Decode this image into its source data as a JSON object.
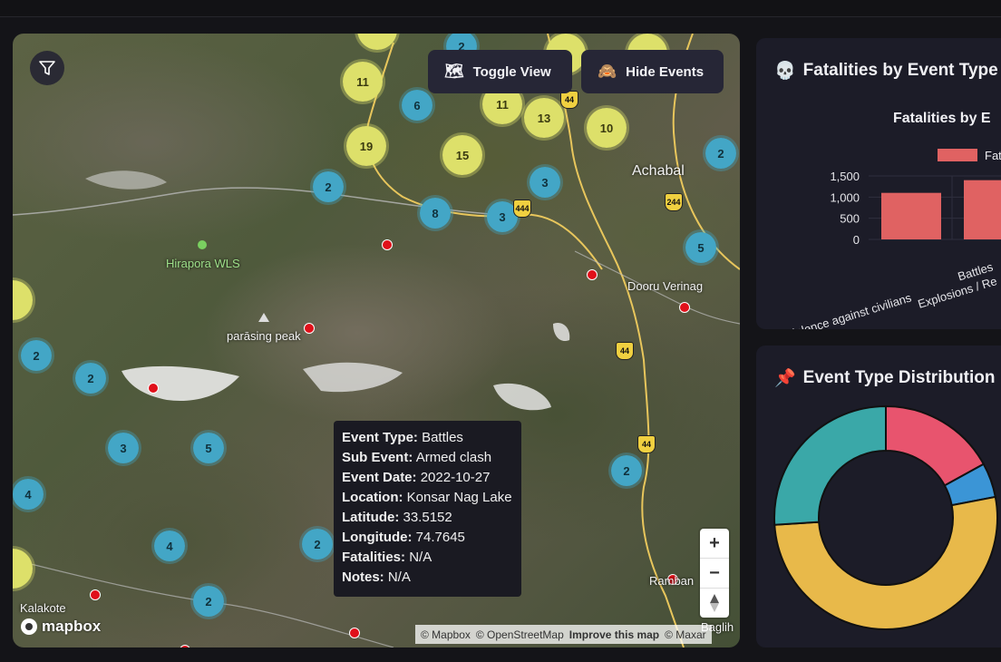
{
  "map": {
    "buttons": {
      "toggle_view": "Toggle View",
      "hide_events": "Hide Events"
    },
    "places": [
      {
        "id": "achabal",
        "label": "Achabal"
      },
      {
        "id": "hirapora",
        "label": "Hirapora WLS"
      },
      {
        "id": "parasing",
        "label": "parāsing peak"
      },
      {
        "id": "dooru",
        "label": "Dooru Verinag"
      },
      {
        "id": "kalakote",
        "label": "Kalakote"
      },
      {
        "id": "ramban",
        "label": "Ramban"
      },
      {
        "id": "baglihar",
        "label": "Baglih"
      }
    ],
    "highway_labels": [
      "44",
      "444",
      "244",
      "44",
      "44"
    ],
    "clusters": [
      {
        "count": "11",
        "color": "yellow"
      },
      {
        "count": "19",
        "color": "yellow"
      },
      {
        "count": "15",
        "color": "yellow"
      },
      {
        "count": "11",
        "color": "yellow"
      },
      {
        "count": "13",
        "color": "yellow"
      },
      {
        "count": "10",
        "color": "yellow"
      },
      {
        "count": "6",
        "color": "blue"
      },
      {
        "count": "2",
        "color": "blue"
      },
      {
        "count": "8",
        "color": "blue"
      },
      {
        "count": "3",
        "color": "blue"
      },
      {
        "count": "3",
        "color": "blue"
      },
      {
        "count": "2",
        "color": "blue"
      },
      {
        "count": "5",
        "color": "blue"
      },
      {
        "count": "2",
        "color": "blue"
      },
      {
        "count": "2",
        "color": "blue"
      },
      {
        "count": "3",
        "color": "blue"
      },
      {
        "count": "5",
        "color": "blue"
      },
      {
        "count": "4",
        "color": "blue"
      },
      {
        "count": "4",
        "color": "blue"
      },
      {
        "count": "2",
        "color": "blue"
      },
      {
        "count": "2",
        "color": "blue"
      },
      {
        "count": "2",
        "color": "blue"
      },
      {
        "count": "2",
        "color": "blue"
      }
    ],
    "tooltip": {
      "fields": [
        {
          "label": "Event Type:",
          "value": "Battles"
        },
        {
          "label": "Sub Event:",
          "value": "Armed clash"
        },
        {
          "label": "Event Date:",
          "value": "2022-10-27"
        },
        {
          "label": "Location:",
          "value": "Konsar Nag Lake"
        },
        {
          "label": "Latitude:",
          "value": "33.5152"
        },
        {
          "label": "Longitude:",
          "value": "74.7645"
        },
        {
          "label": "Fatalities:",
          "value": "N/A"
        },
        {
          "label": "Notes:",
          "value": "N/A"
        }
      ]
    },
    "zoom": {
      "in": "+",
      "out": "−"
    },
    "logo": "mapbox",
    "attribution": {
      "mapbox": "© Mapbox",
      "osm": "© OpenStreetMap",
      "improve": "Improve this map",
      "maxar": "© Maxar"
    }
  },
  "panels": {
    "fatalities": {
      "title": "Fatalities by Event Type",
      "icon": "💀",
      "chart_title": "Fatalities by E",
      "legend": "Fat"
    },
    "distribution": {
      "title": "Event Type Distribution",
      "icon": "📌"
    }
  },
  "chart_data": [
    {
      "type": "bar",
      "title": "Fatalities by E",
      "categories": [
        "Violence against civilians",
        "Battles",
        "Explosions / Re"
      ],
      "series": [
        {
          "name": "Fat",
          "values": [
            1100,
            1400
          ]
        }
      ],
      "yticks": [
        "1,500",
        "1,000",
        "500",
        "0"
      ],
      "ylim": [
        0,
        1500
      ],
      "colors": {
        "bar": "#e06262"
      }
    },
    {
      "type": "pie",
      "variant": "doughnut",
      "slices": [
        {
          "value": 17,
          "color": "#e8546e"
        },
        {
          "value": 5,
          "color": "#3b95d6"
        },
        {
          "value": 52,
          "color": "#e8b94a"
        },
        {
          "value": 26,
          "color": "#3aa8a8"
        }
      ]
    }
  ],
  "colors": {
    "accent_yellow": "#dde06a",
    "accent_blue": "#43a6c6",
    "event_red": "#e0101a",
    "panel_bg": "#1c1c28"
  }
}
